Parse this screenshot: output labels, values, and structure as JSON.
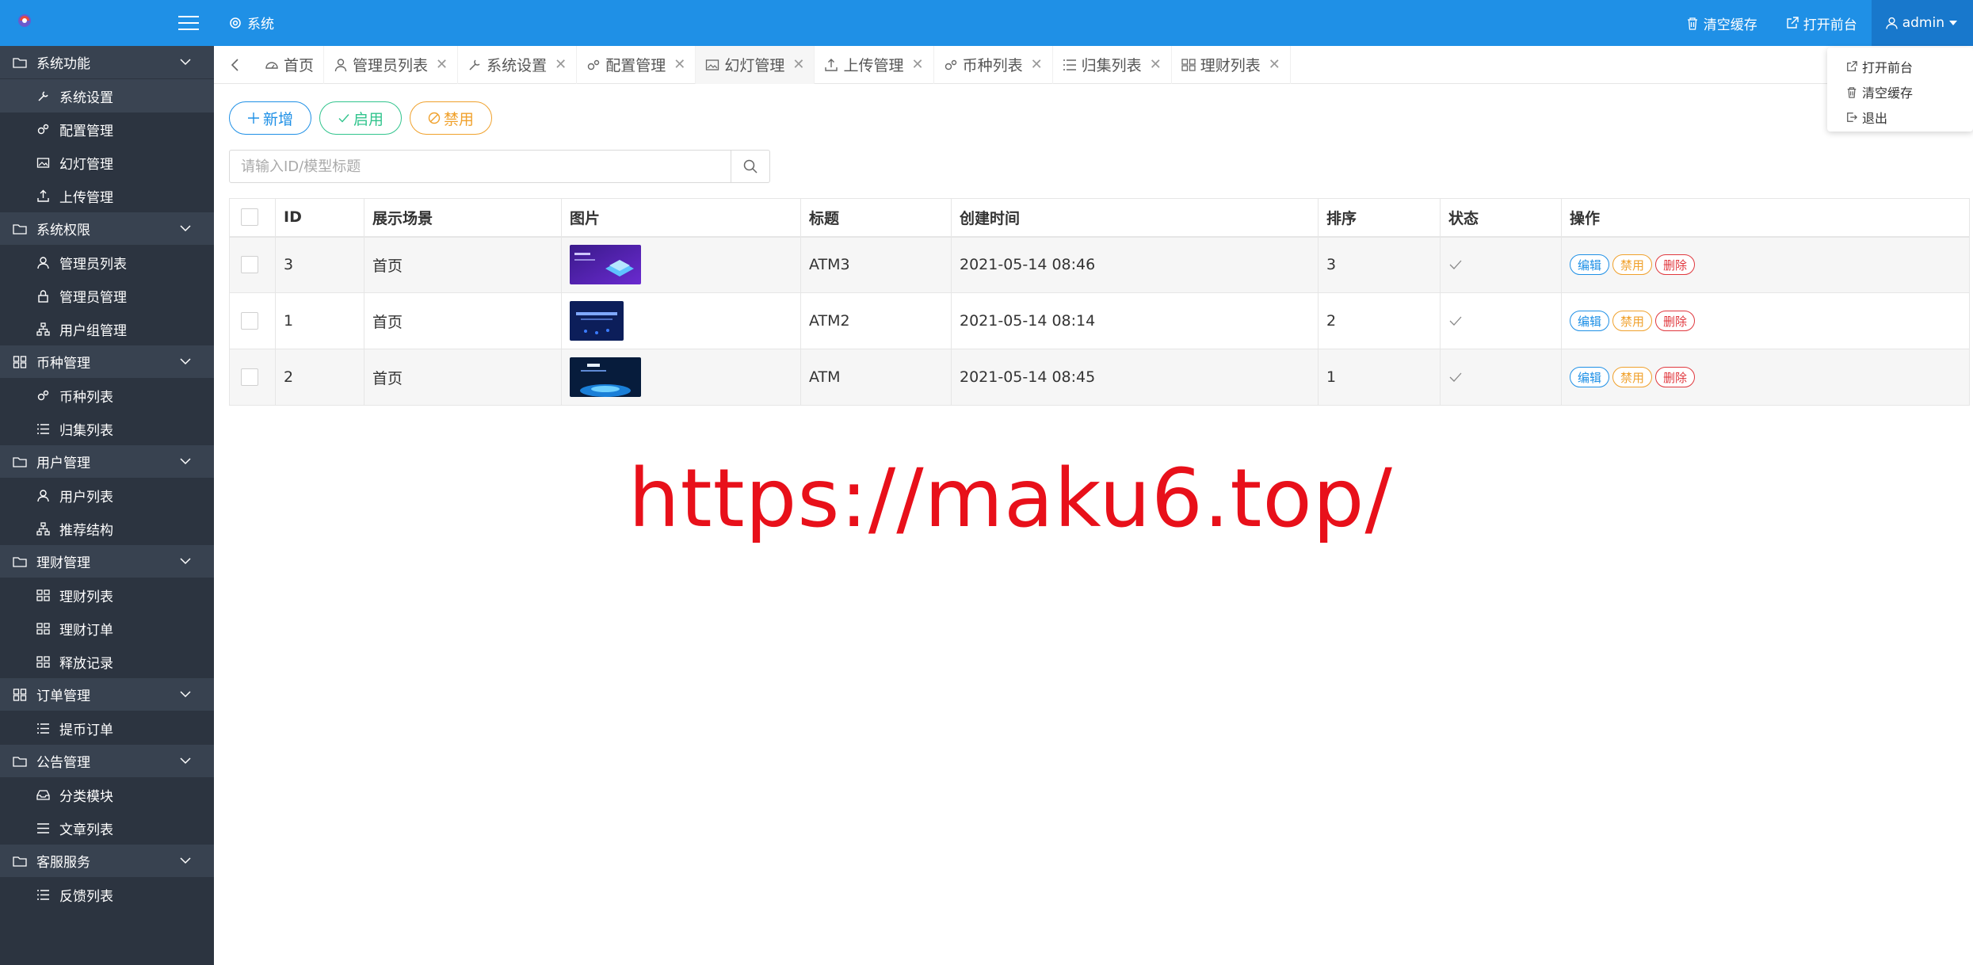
{
  "sidebar": {
    "groups": [
      {
        "label": "系统功能",
        "items": [
          {
            "label": "系统设置",
            "active": true
          },
          {
            "label": "配置管理"
          },
          {
            "label": "幻灯管理"
          },
          {
            "label": "上传管理"
          }
        ]
      },
      {
        "label": "系统权限",
        "items": [
          {
            "label": "管理员列表"
          },
          {
            "label": "管理员管理"
          },
          {
            "label": "用户组管理"
          }
        ]
      },
      {
        "label": "币种管理",
        "items": [
          {
            "label": "币种列表"
          },
          {
            "label": "归集列表"
          }
        ]
      },
      {
        "label": "用户管理",
        "items": [
          {
            "label": "用户列表"
          },
          {
            "label": "推荐结构"
          }
        ]
      },
      {
        "label": "理财管理",
        "items": [
          {
            "label": "理财列表"
          },
          {
            "label": "理财订单"
          },
          {
            "label": "释放记录"
          }
        ]
      },
      {
        "label": "订单管理",
        "items": [
          {
            "label": "提币订单"
          }
        ]
      },
      {
        "label": "公告管理",
        "items": [
          {
            "label": "分类模块"
          },
          {
            "label": "文章列表"
          }
        ]
      },
      {
        "label": "客服服务",
        "items": [
          {
            "label": "反馈列表"
          }
        ]
      }
    ]
  },
  "topbar": {
    "brand": "系统",
    "clear_cache": "清空缓存",
    "open_frontend": "打开前台",
    "user": "admin"
  },
  "tabs": [
    {
      "label": "首页",
      "closable": false
    },
    {
      "label": "管理员列表",
      "closable": true
    },
    {
      "label": "系统设置",
      "closable": true
    },
    {
      "label": "配置管理",
      "closable": true
    },
    {
      "label": "幻灯管理",
      "closable": true,
      "active": true
    },
    {
      "label": "上传管理",
      "closable": true
    },
    {
      "label": "币种列表",
      "closable": true
    },
    {
      "label": "归集列表",
      "closable": true
    },
    {
      "label": "理财列表",
      "closable": true
    }
  ],
  "dropdown": {
    "items": [
      "打开前台",
      "清空缓存",
      "退出"
    ]
  },
  "toolbar": {
    "add": "新增",
    "enable": "启用",
    "disable": "禁用"
  },
  "search": {
    "placeholder": "请输入ID/模型标题"
  },
  "table": {
    "headers": [
      "ID",
      "展示场景",
      "图片",
      "标题",
      "创建时间",
      "排序",
      "状态",
      "操作"
    ],
    "rows": [
      {
        "id": "3",
        "scene": "首页",
        "title": "ATM3",
        "created": "2021-05-14 08:46",
        "sort": "3"
      },
      {
        "id": "1",
        "scene": "首页",
        "title": "ATM2",
        "created": "2021-05-14 08:14",
        "sort": "2"
      },
      {
        "id": "2",
        "scene": "首页",
        "title": "ATM",
        "created": "2021-05-14 08:45",
        "sort": "1"
      }
    ],
    "op_edit": "编辑",
    "op_disable": "禁用",
    "op_delete": "删除"
  },
  "watermark": "https://maku6.top/",
  "colors": {
    "primary": "#1f90e6",
    "sidebar_bg": "#2c3440",
    "success": "#31c48d",
    "warning": "#f0a12c",
    "danger": "#e0383e",
    "watermark": "#e8101a"
  }
}
